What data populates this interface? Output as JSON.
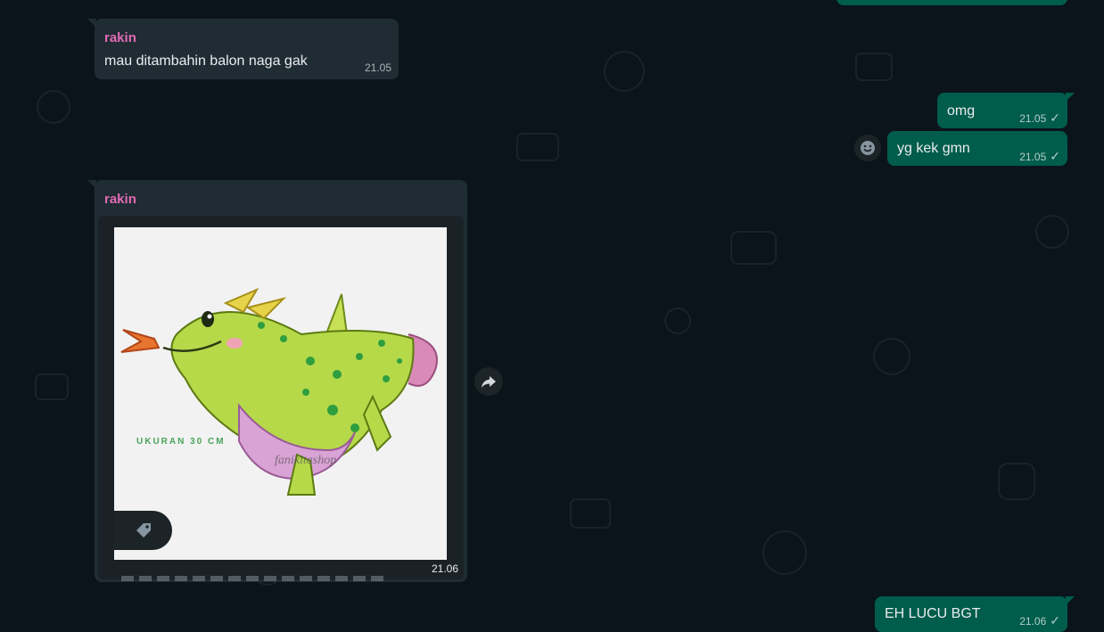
{
  "chat": {
    "messages": [
      {
        "type": "in",
        "sender": "rakin",
        "text": "mau ditambahin balon naga gak",
        "time": "21.05"
      },
      {
        "type": "out",
        "text": "omg",
        "time": "21.05"
      },
      {
        "type": "out",
        "text": "yg kek gmn",
        "time": "21.05"
      },
      {
        "type": "in-image",
        "sender": "rakin",
        "image_text": "UKURAN 30 CM",
        "watermark": "fanikitashop",
        "time": "21.06"
      },
      {
        "type": "out",
        "text": "EH LUCU BGT",
        "time": "21.06"
      }
    ]
  },
  "icons": {
    "forward": "forward-arrow-icon",
    "react": "emoji-smile-icon",
    "tag": "tag-icon",
    "read": "checkmark-icon"
  },
  "colors": {
    "background": "#0b141a",
    "incoming": "#202c33",
    "outgoing": "#005c4b",
    "sender_name": "#e26ab6"
  }
}
